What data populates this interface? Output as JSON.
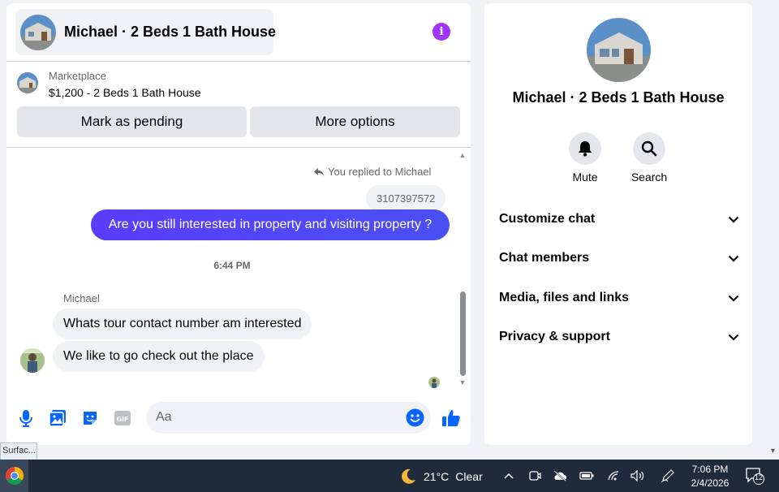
{
  "chat": {
    "title": "Michael · 2 Beds 1 Bath House",
    "marketplace_label": "Marketplace",
    "listing": "$1,200 - 2 Beds 1 Bath House",
    "mark_pending_label": "Mark as pending",
    "more_options_label": "More options",
    "replied_label": "You replied to Michael",
    "quoted_text": "3107397572",
    "outgoing_message": "Are you still interested in property and visiting property ?",
    "timestamp": "6:44 PM",
    "sender_name": "Michael",
    "incoming_messages": [
      "Whats tour contact number am interested",
      "We like to go check out the place"
    ],
    "composer_placeholder": "Aa"
  },
  "details": {
    "title": "Michael · 2 Beds 1 Bath House",
    "actions": [
      {
        "label": "Mute",
        "icon": "bell-icon"
      },
      {
        "label": "Search",
        "icon": "search-icon"
      }
    ],
    "sections": [
      "Customize chat",
      "Chat members",
      "Media, files and links",
      "Privacy & support"
    ]
  },
  "tooltip": "Surfac...",
  "taskbar": {
    "temperature": "21°C",
    "weather": "Clear",
    "time": "7:06 PM",
    "date": "2/4/2026",
    "notification_count": "12"
  },
  "colors": {
    "accent": "#4a4ff2",
    "info": "#a033ff",
    "icon_blue": "#0866ff"
  }
}
